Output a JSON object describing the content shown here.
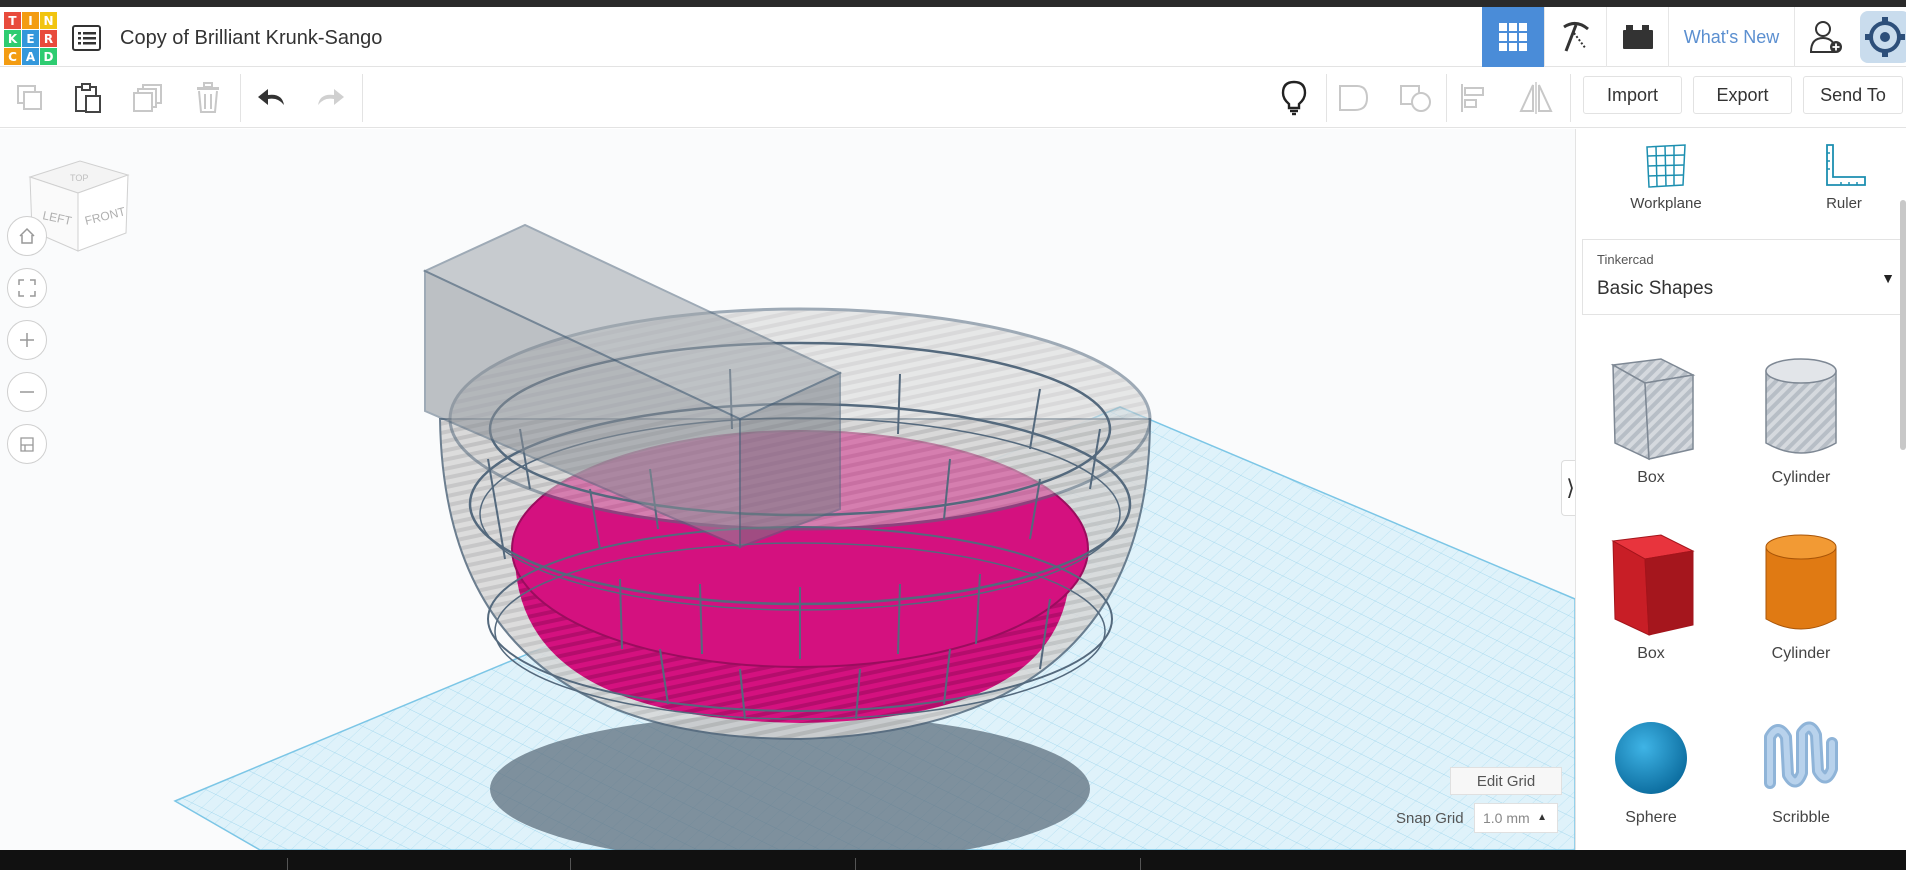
{
  "app": {
    "title": "Copy of Brilliant Krunk-Sango",
    "logo_letters": [
      "T",
      "I",
      "N",
      "K",
      "E",
      "R",
      "C",
      "A",
      "D"
    ],
    "logo_colors": [
      "#e84b3c",
      "#f39c12",
      "#f1c40f",
      "#2ecc71",
      "#3498db",
      "#e84b3c",
      "#f39c12",
      "#3498db",
      "#2ecc71"
    ]
  },
  "header": {
    "whats_new": "What's New",
    "accent": "#4a8cd8"
  },
  "toolbar": {
    "import_label": "Import",
    "export_label": "Export",
    "send_to_label": "Send To"
  },
  "viewcube": {
    "top": "TOP",
    "left": "LEFT",
    "front": "FRONT"
  },
  "workplane": {
    "edit_grid": "Edit Grid",
    "snap_label": "Snap Grid",
    "snap_value": "1.0 mm"
  },
  "panel": {
    "tools": [
      {
        "label": "Workplane",
        "icon": "workplane-icon"
      },
      {
        "label": "Ruler",
        "icon": "ruler-icon"
      }
    ],
    "library_sub": "Tinkercad",
    "library_name": "Basic Shapes",
    "shapes": [
      {
        "label": "Box",
        "icon": "box-hole-icon"
      },
      {
        "label": "Cylinder",
        "icon": "cylinder-hole-icon"
      },
      {
        "label": "Box",
        "icon": "box-icon"
      },
      {
        "label": "Cylinder",
        "icon": "cylinder-icon"
      },
      {
        "label": "Sphere",
        "icon": "sphere-icon"
      },
      {
        "label": "Scribble",
        "icon": "scribble-icon"
      }
    ]
  },
  "model": {
    "solid_color": "#d4117f",
    "grid_color": "#8fd0ea"
  }
}
